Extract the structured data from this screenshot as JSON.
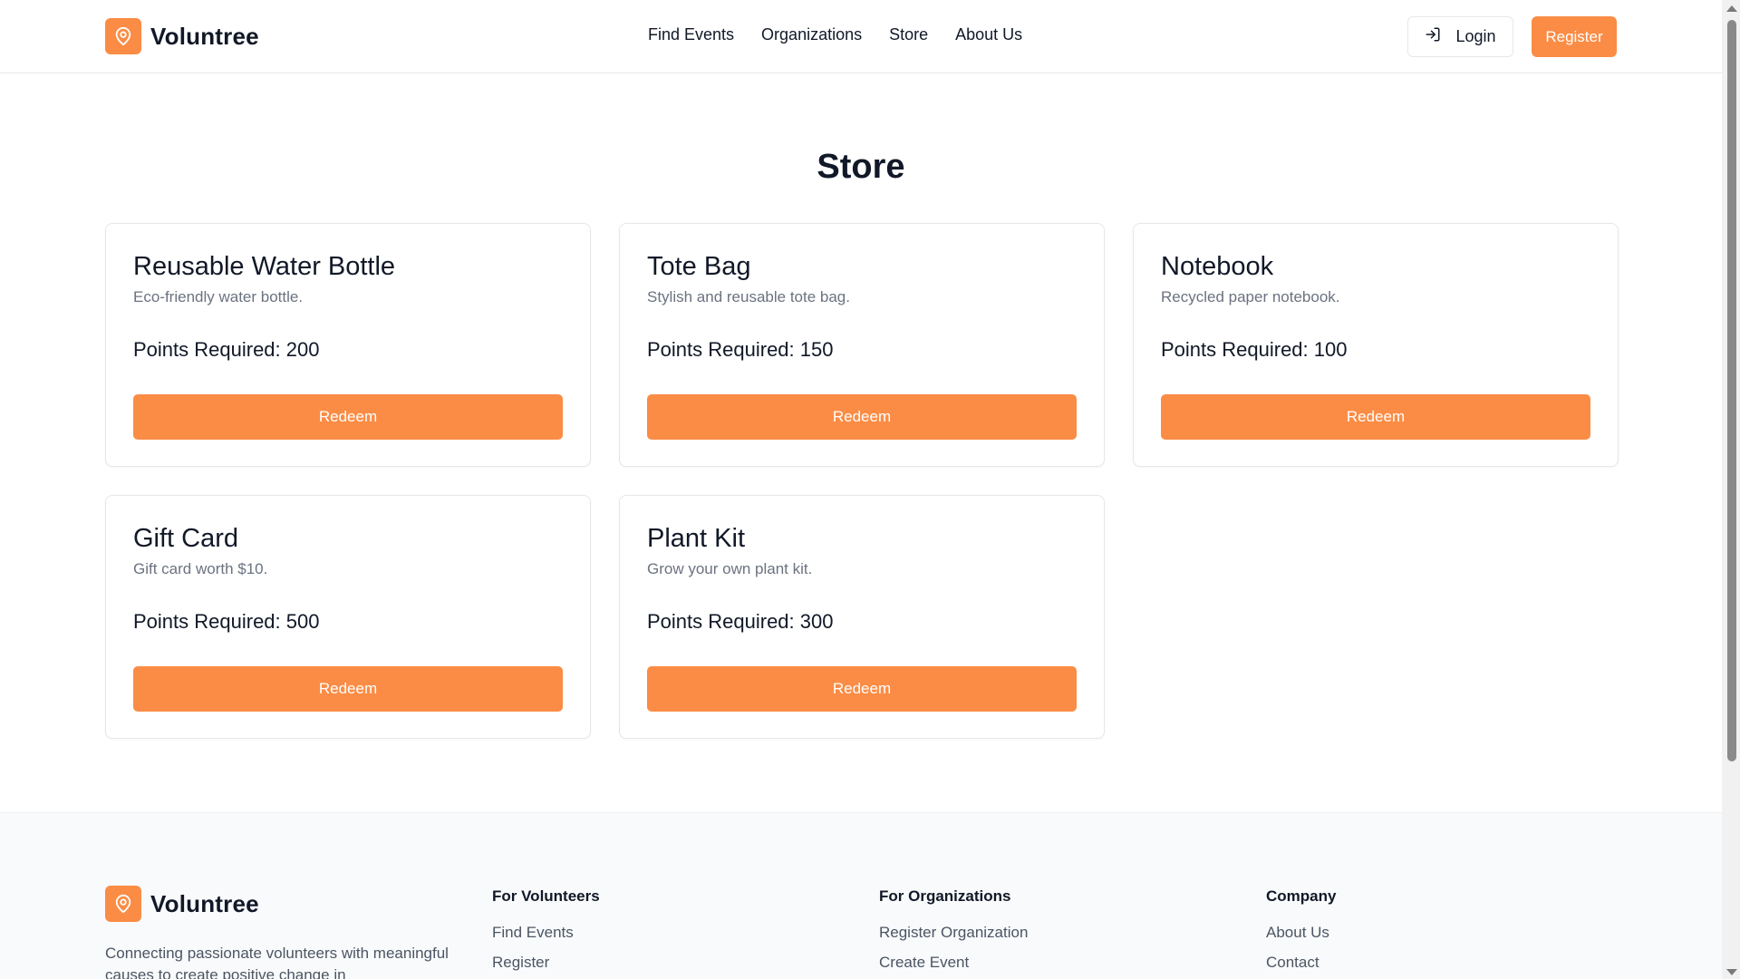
{
  "header": {
    "brand": "Voluntree",
    "nav": [
      "Find Events",
      "Organizations",
      "Store",
      "About Us"
    ],
    "login_label": "Login",
    "register_label": "Register"
  },
  "main": {
    "title": "Store",
    "items": [
      {
        "name": "Reusable Water Bottle",
        "description": "Eco-friendly water bottle.",
        "points": "Points Required: 200",
        "button": "Redeem"
      },
      {
        "name": "Tote Bag",
        "description": "Stylish and reusable tote bag.",
        "points": "Points Required: 150",
        "button": "Redeem"
      },
      {
        "name": "Notebook",
        "description": "Recycled paper notebook.",
        "points": "Points Required: 100",
        "button": "Redeem"
      },
      {
        "name": "Gift Card",
        "description": "Gift card worth $10.",
        "points": "Points Required: 500",
        "button": "Redeem"
      },
      {
        "name": "Plant Kit",
        "description": "Grow your own plant kit.",
        "points": "Points Required: 300",
        "button": "Redeem"
      }
    ]
  },
  "footer": {
    "brand": "Voluntree",
    "description": "Connecting passionate volunteers with meaningful causes to create positive change in",
    "columns": [
      {
        "heading": "For Volunteers",
        "links": [
          "Find Events",
          "Register"
        ]
      },
      {
        "heading": "For Organizations",
        "links": [
          "Register Organization",
          "Create Event"
        ]
      },
      {
        "heading": "Company",
        "links": [
          "About Us",
          "Contact"
        ]
      }
    ]
  },
  "colors": {
    "accent": "#fb8c45",
    "text": "#111827",
    "muted": "#6b7280",
    "border": "#e5e7eb"
  },
  "icons": {
    "logo": "map-pin-icon",
    "login": "log-in-icon"
  }
}
